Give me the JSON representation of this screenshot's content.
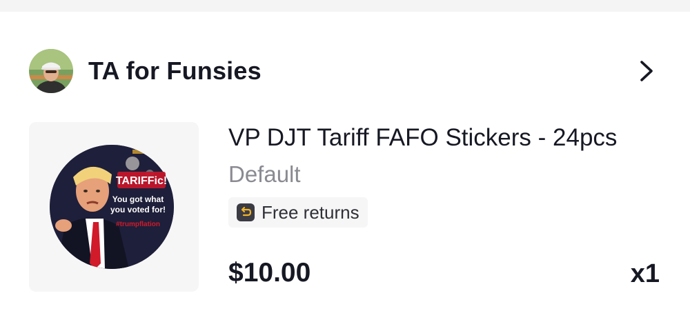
{
  "shop": {
    "name": "TA for Funsies",
    "avatar_icon": "user-avatar",
    "chevron_icon": "chevron-right-icon"
  },
  "product": {
    "title": "VP DJT Tariff FAFO Stickers - 24pcs",
    "variant": "Default",
    "badge": {
      "icon": "return-arrow-icon",
      "label": "Free returns"
    },
    "price": "$10.00",
    "quantity": "x1",
    "sticker_text": {
      "headline": "TARIFFic!",
      "line1": "You got what",
      "line2": "you voted for!",
      "hashtag": "#trumpflation"
    }
  },
  "colors": {
    "text_primary": "#161823",
    "text_secondary": "#8a8b91",
    "badge_bg": "#f6f6f7",
    "accent_gold": "#f0b428"
  }
}
